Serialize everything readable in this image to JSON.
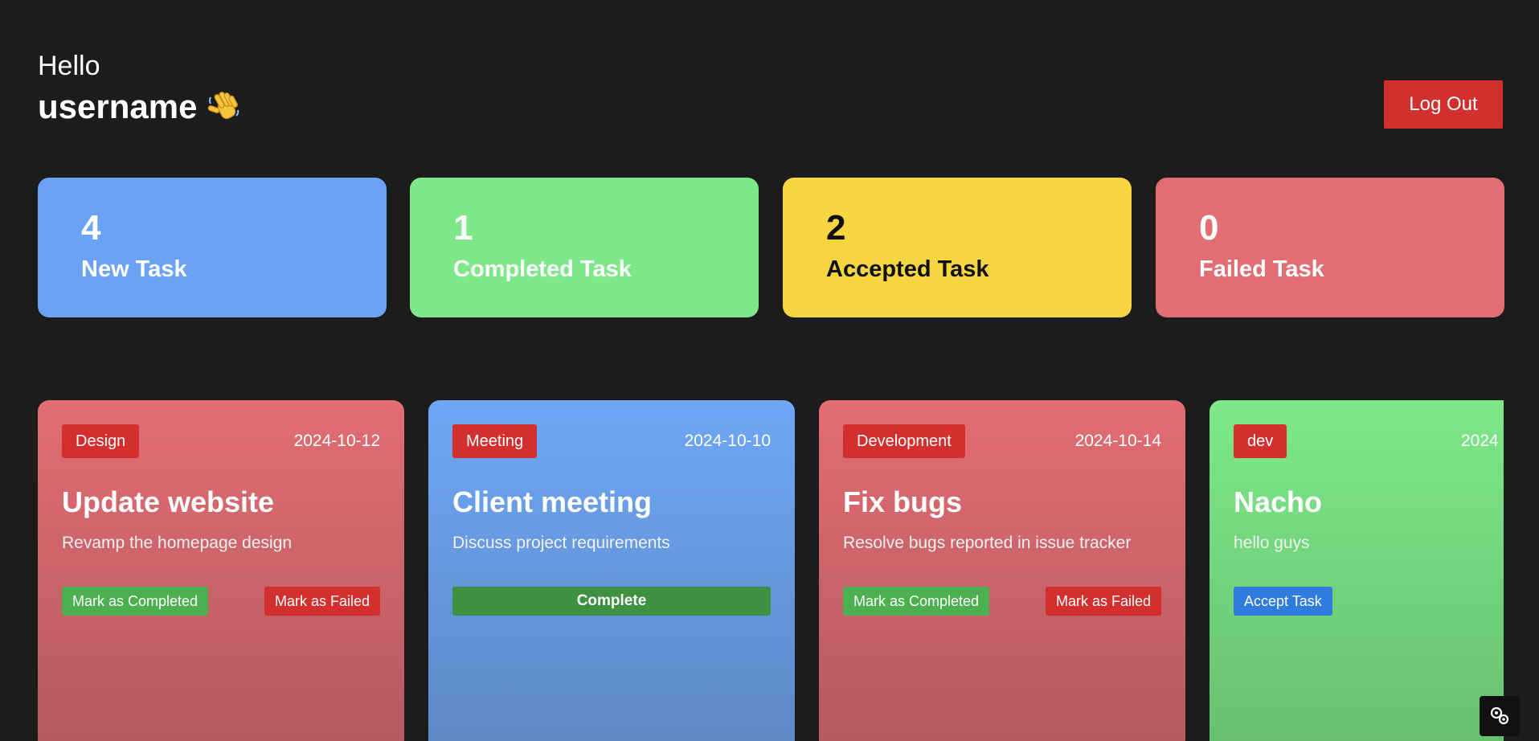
{
  "header": {
    "hello": "Hello",
    "username": "username",
    "wave_icon": "waving-hand-emoji",
    "logout_label": "Log Out"
  },
  "stats": [
    {
      "count": "4",
      "label": "New Task",
      "color": "#6aa3f5"
    },
    {
      "count": "1",
      "label": "Completed Task",
      "color": "#7ee889"
    },
    {
      "count": "2",
      "label": "Accepted Task",
      "color": "#f5d540"
    },
    {
      "count": "0",
      "label": "Failed Task",
      "color": "#e26d73"
    }
  ],
  "tasks": [
    {
      "category": "Design",
      "date": "2024-10-12",
      "title": "Update website",
      "description": "Revamp the homepage design",
      "status": "accepted",
      "actions": [
        "Mark as Completed",
        "Mark as Failed"
      ]
    },
    {
      "category": "Meeting",
      "date": "2024-10-10",
      "title": "Client meeting",
      "description": "Discuss project requirements",
      "status": "completed",
      "actions": [
        "Complete"
      ]
    },
    {
      "category": "Development",
      "date": "2024-10-14",
      "title": "Fix bugs",
      "description": "Resolve bugs reported in issue tracker",
      "status": "accepted",
      "actions": [
        "Mark as Completed",
        "Mark as Failed"
      ]
    },
    {
      "category": "dev",
      "date": "2024",
      "title": "Nacho",
      "description": "hello guys",
      "status": "new",
      "actions": [
        "Accept Task"
      ]
    }
  ],
  "colors": {
    "background": "#1c1c1c",
    "danger": "#d32f2f",
    "success": "#4caf50",
    "primary": "#2f7be0"
  },
  "overlay_icon": "channel-watermark-icon"
}
